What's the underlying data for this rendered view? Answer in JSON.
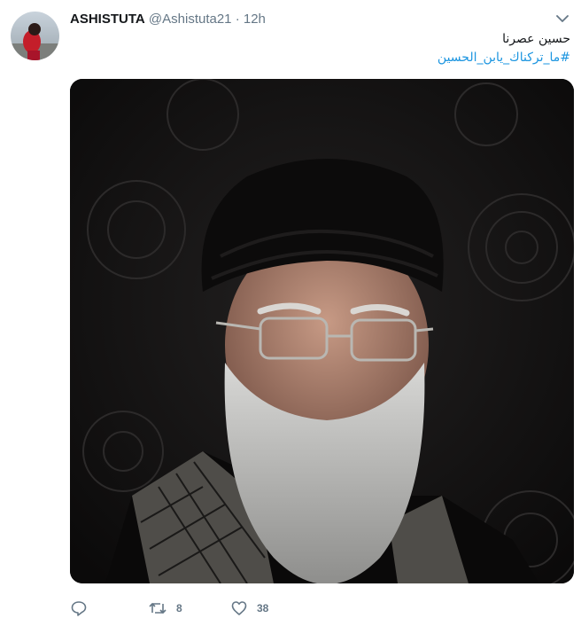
{
  "tweet": {
    "display_name": "ASHISTUTA",
    "handle": "@Ashistuta21",
    "separator": "·",
    "time": "12h",
    "text_line1": "حسين عصرنا",
    "hashtag": "#ما_تركناك_يابن_الحسين"
  },
  "actions": {
    "reply_count": "",
    "retweet_count": "8",
    "like_count": "38"
  },
  "icons": {
    "chevron": "chevron-down-icon",
    "reply": "reply-icon",
    "retweet": "retweet-icon",
    "like": "heart-icon"
  },
  "colors": {
    "name": "#14171a",
    "secondary": "#657786",
    "link": "#1b95e0",
    "media_background": "#0e0d0d"
  }
}
